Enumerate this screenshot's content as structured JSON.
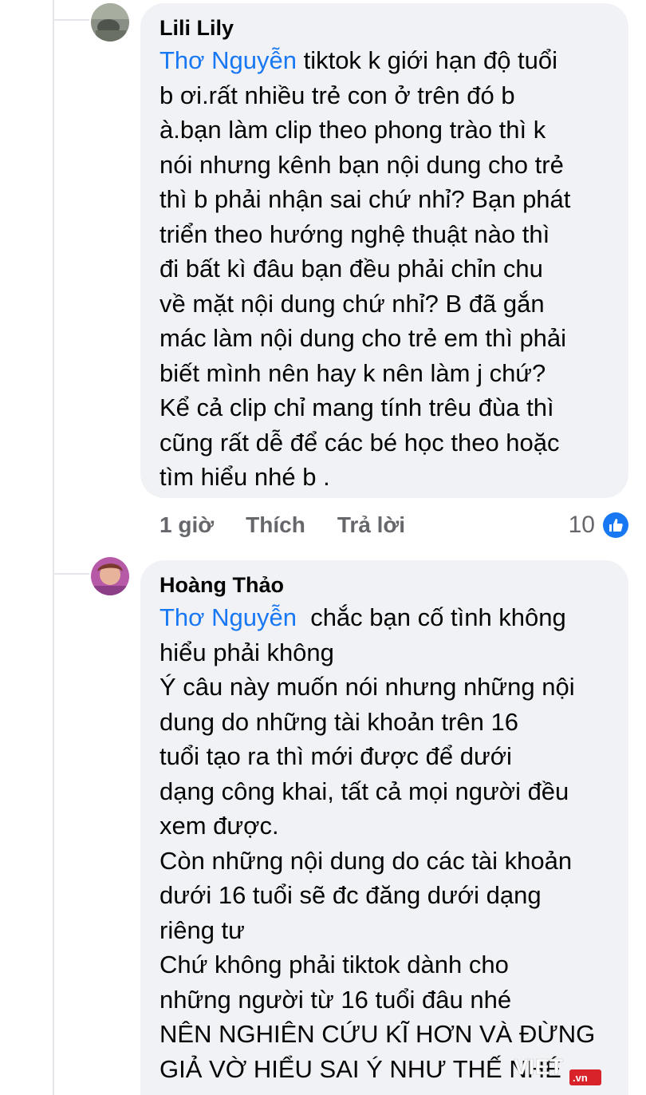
{
  "comments": [
    {
      "author": "Lili Lily",
      "mention": "Thơ Nguyễn",
      "body": " tiktok k giới hạn độ tuổi\nb ơi.rất nhiều trẻ con ở trên đó b\nà.bạn làm clip theo phong trào thì k\nnói nhưng kênh bạn nội dung cho trẻ\nthì b phải nhận sai chứ nhỉ? Bạn phát\ntriển theo hướng nghệ thuật nào thì\nđi bất kì đâu bạn đều phải chỉn chu\nvề mặt nội dung chứ nhỉ? B đã gắn\nmác làm nội dung cho trẻ em thì phải\nbiết mình nên hay k nên làm j chứ?\nKể cả clip chỉ mang tính trêu đùa thì\ncũng rất dễ để các bé học theo hoặc\ntìm hiểu nhé b .",
      "time": "1 giờ",
      "like_label": "Thích",
      "reply_label": "Trả lời",
      "reaction_count": "10",
      "reaction_icon": "like-icon"
    },
    {
      "author": "Hoàng Thảo",
      "mention": "Thơ Nguyễn",
      "body": "  chắc bạn cố tình không\nhiểu phải không\nÝ câu này muốn nói nhưng những nội\ndung do những tài khoản trên 16\ntuổi tạo ra thì mới được để dưới\ndạng công khai, tất cả mọi người đều\nxem được.\nCòn những nội dung do các tài khoản\ndưới 16 tuổi sẽ đc đăng dưới dạng\nriêng tư\nChứ không phải tiktok dành cho\nnhững người từ 16 tuổi đâu nhé\nNÊN NGHIÊN CỨU KĨ HƠN VÀ ĐỪNG\nGIẢ VỜ HIỂU SAI Ý NHƯ THẾ NHÉ"
    }
  ],
  "watermark": {
    "brand": "VIET",
    "suffix": ".vn"
  },
  "colors": {
    "mention": "#1877f2",
    "bubble": "#f0f2f5",
    "meta": "#65676b"
  }
}
